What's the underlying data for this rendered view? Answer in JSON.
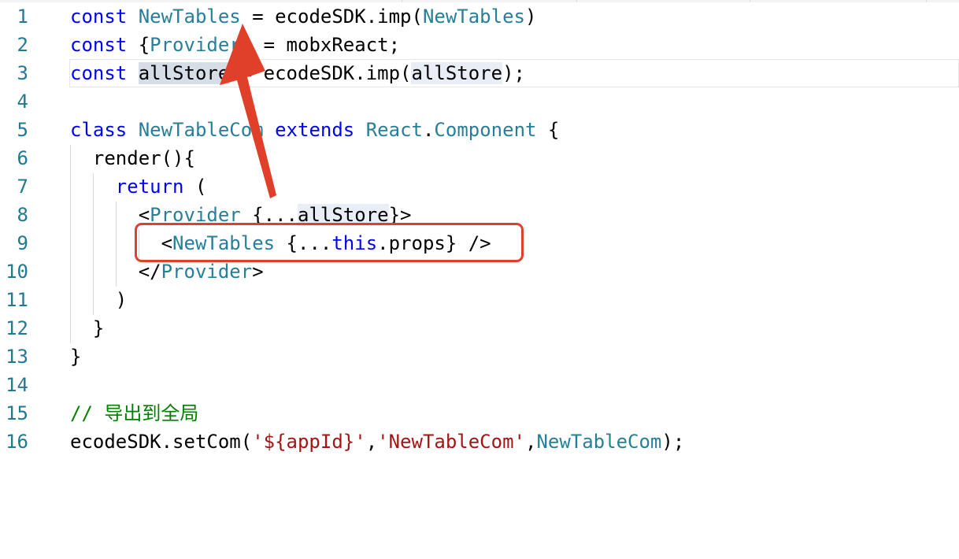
{
  "editor": {
    "lines": [
      {
        "no": "1",
        "tokens": [
          [
            "kw",
            "const"
          ],
          [
            "pl",
            " "
          ],
          [
            "ty",
            "NewTables"
          ],
          [
            "pl",
            " = ecodeSDK.imp("
          ],
          [
            "ty",
            "NewTables"
          ],
          [
            "pl",
            ")"
          ]
        ]
      },
      {
        "no": "2",
        "tokens": [
          [
            "kw",
            "const"
          ],
          [
            "pl",
            " {"
          ],
          [
            "ty",
            "Provider"
          ],
          [
            "pl",
            "} = mobxReact;"
          ]
        ]
      },
      {
        "no": "3",
        "tokens": [
          [
            "kw",
            "const"
          ],
          [
            "pl",
            " "
          ],
          [
            "hl",
            "allStore"
          ],
          [
            "pl",
            " = ecodeSDK.imp("
          ],
          [
            "hl2",
            "allStore"
          ],
          [
            "pl",
            ");"
          ]
        ]
      },
      {
        "no": "4",
        "tokens": []
      },
      {
        "no": "5",
        "tokens": [
          [
            "kw",
            "class"
          ],
          [
            "pl",
            " "
          ],
          [
            "ty",
            "NewTableCom"
          ],
          [
            "pl",
            " "
          ],
          [
            "kw",
            "extends"
          ],
          [
            "pl",
            " "
          ],
          [
            "ty",
            "React"
          ],
          [
            "pl",
            "."
          ],
          [
            "ty",
            "Component"
          ],
          [
            "pl",
            " {"
          ]
        ]
      },
      {
        "no": "6",
        "tokens": [
          [
            "pl",
            "  render(){"
          ]
        ]
      },
      {
        "no": "7",
        "tokens": [
          [
            "pl",
            "    "
          ],
          [
            "kw",
            "return"
          ],
          [
            "pl",
            " ("
          ]
        ]
      },
      {
        "no": "8",
        "tokens": [
          [
            "pl",
            "      <"
          ],
          [
            "ty",
            "Provider"
          ],
          [
            "pl",
            " {..."
          ],
          [
            "hl2",
            "allStore"
          ],
          [
            "pl",
            "}>"
          ]
        ]
      },
      {
        "no": "9",
        "tokens": [
          [
            "pl",
            "        <"
          ],
          [
            "ty",
            "NewTables"
          ],
          [
            "pl",
            " {..."
          ],
          [
            "kw",
            "this"
          ],
          [
            "pl",
            ".props} />"
          ]
        ]
      },
      {
        "no": "10",
        "tokens": [
          [
            "pl",
            "      </"
          ],
          [
            "ty",
            "Provider"
          ],
          [
            "pl",
            ">"
          ]
        ]
      },
      {
        "no": "11",
        "tokens": [
          [
            "pl",
            "    )"
          ]
        ]
      },
      {
        "no": "12",
        "tokens": [
          [
            "pl",
            "  }"
          ]
        ]
      },
      {
        "no": "13",
        "tokens": [
          [
            "pl",
            "}"
          ]
        ]
      },
      {
        "no": "14",
        "tokens": []
      },
      {
        "no": "15",
        "tokens": [
          [
            "cm",
            "// 导出到全局"
          ]
        ]
      },
      {
        "no": "16",
        "tokens": [
          [
            "pl",
            "ecodeSDK.setCom("
          ],
          [
            "str",
            "'${appId}'"
          ],
          [
            "pl",
            ","
          ],
          [
            "str",
            "'NewTableCom'"
          ],
          [
            "pl",
            ","
          ],
          [
            "ty",
            "NewTableCom"
          ],
          [
            "pl",
            ");"
          ]
        ]
      }
    ],
    "current_line": 3
  },
  "colors": {
    "keyword": "#0000ff",
    "type": "#267f99",
    "string": "#a31515",
    "comment": "#008000",
    "line_number": "#237893",
    "annotation": "#e0402a"
  }
}
